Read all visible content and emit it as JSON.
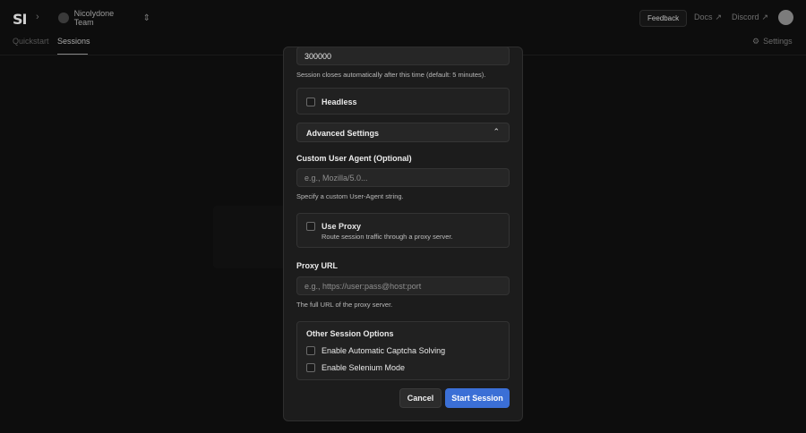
{
  "app": {
    "logo_text": "SI",
    "team_name": "Nicolydone Team",
    "feedback_label": "Feedback",
    "docs_label": "Docs",
    "discord_label": "Discord",
    "settings_label": "Settings"
  },
  "nav": {
    "tabs": [
      {
        "label": "Quickstart",
        "active": false
      },
      {
        "label": "Sessions",
        "active": true
      }
    ]
  },
  "modal": {
    "timeout_value": "300000",
    "timeout_help": "Session closes automatically after this time (default: 5 minutes).",
    "headless_label": "Headless",
    "advanced_label": "Advanced Settings",
    "user_agent": {
      "label": "Custom User Agent (Optional)",
      "placeholder": "e.g., Mozilla/5.0...",
      "help": "Specify a custom User-Agent string."
    },
    "proxy": {
      "use_label": "Use Proxy",
      "use_help": "Route session traffic through a proxy server.",
      "url_label": "Proxy URL",
      "url_placeholder": "e.g., https://user:pass@host:port",
      "url_help": "The full URL of the proxy server."
    },
    "other": {
      "title": "Other Session Options",
      "captcha_label": "Enable Automatic Captcha Solving",
      "selenium_label": "Enable Selenium Mode"
    },
    "cancel_label": "Cancel",
    "start_label": "Start Session"
  },
  "colors": {
    "accent": "#3b6fd6",
    "background": "#0d0d0d",
    "modal": "#1c1c1c"
  }
}
